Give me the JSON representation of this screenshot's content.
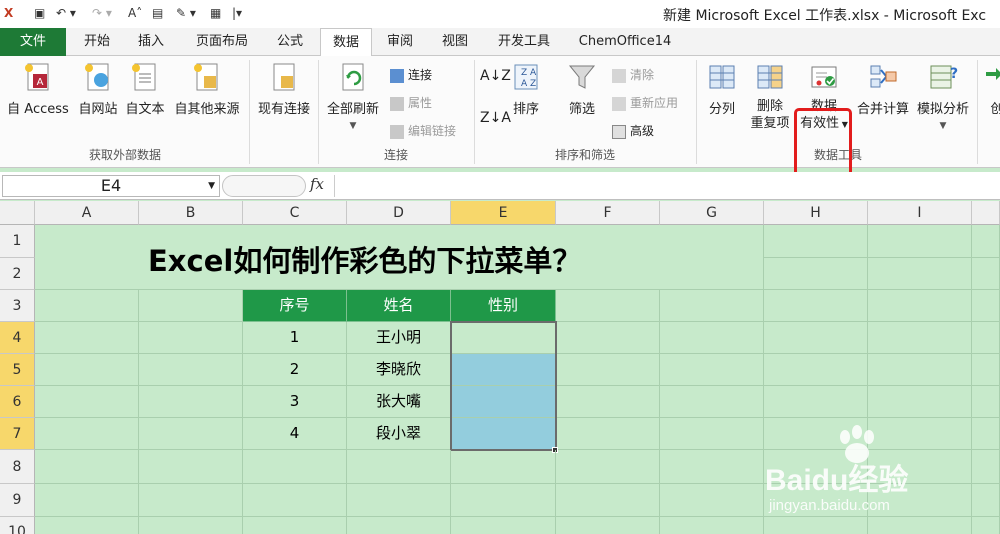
{
  "window": {
    "title": "新建 Microsoft Excel 工作表.xlsx - Microsoft Exc"
  },
  "tabs": [
    "文件",
    "开始",
    "插入",
    "页面布局",
    "公式",
    "数据",
    "审阅",
    "视图",
    "开发工具",
    "ChemOffice14"
  ],
  "ribbon": {
    "get_external": {
      "access": "自 Access",
      "web": "自网站",
      "text": "自文本",
      "other": "自其他来源",
      "group": "获取外部数据"
    },
    "existing": "现有连接",
    "connections": {
      "refresh": "全部刷新",
      "connect": "连接",
      "properties": "属性",
      "edit_links": "编辑链接",
      "group": "连接"
    },
    "sort_filter": {
      "sort": "排序",
      "filter": "筛选",
      "clear": "清除",
      "reapply": "重新应用",
      "advanced": "高级",
      "group": "排序和筛选"
    },
    "data_tools": {
      "split": "分列",
      "remove_dup_1": "删除",
      "remove_dup_2": "重复项",
      "validation_1": "数据",
      "validation_2": "有效性",
      "consolidate": "合并计算",
      "whatif": "模拟分析",
      "group": "数据工具"
    },
    "outline_partial": "创"
  },
  "formula_bar": {
    "name_box": "E4",
    "fx": "fx",
    "value": ""
  },
  "columns": [
    "A",
    "B",
    "C",
    "D",
    "E",
    "F",
    "G",
    "H",
    "I"
  ],
  "rows": [
    "1",
    "2",
    "3",
    "4",
    "5",
    "6",
    "7",
    "8",
    "9",
    "10"
  ],
  "sheet": {
    "title": "Excel如何制作彩色的下拉菜单？",
    "headers": [
      "序号",
      "姓名",
      "性别"
    ],
    "records": [
      {
        "no": "1",
        "name": "王小明",
        "gender": ""
      },
      {
        "no": "2",
        "name": "李晓欣",
        "gender": ""
      },
      {
        "no": "3",
        "name": "张大嘴",
        "gender": ""
      },
      {
        "no": "4",
        "name": "段小翠",
        "gender": ""
      }
    ]
  },
  "watermark": {
    "logo_text": "Baidu经验",
    "url": "jingyan.baidu.com"
  },
  "colors": {
    "grid_bg": "#c7eacb",
    "header_green": "#1f9848",
    "blue_fill": "#93cddd",
    "selected_header": "#f7d76b",
    "highlight_red": "#e21c1c",
    "file_tab": "#1e7a36"
  }
}
